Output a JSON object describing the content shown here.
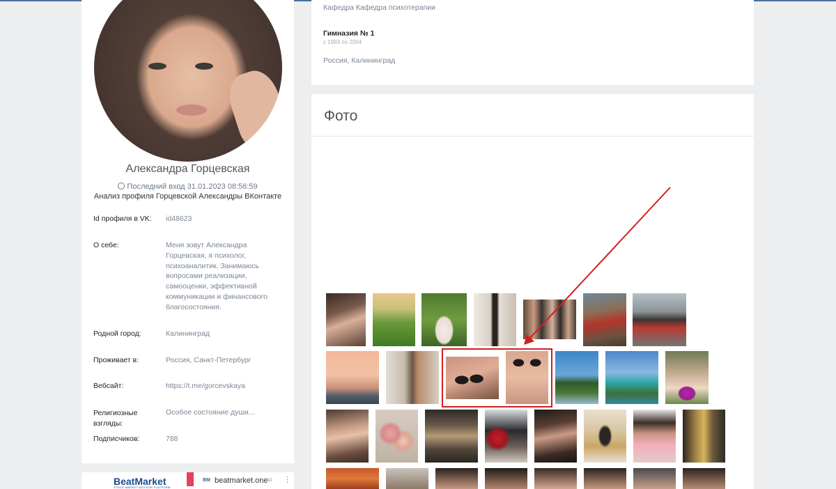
{
  "profile": {
    "name": "Александра Горцевская",
    "last_seen": "Последний вход 31.01.2023 08:56:59",
    "analysis": "Анализ профиля Горцевской Александры ВКонтакте",
    "info": [
      {
        "label": "Id профиля в VK:",
        "value": "id48623"
      },
      {
        "label": "О себе:",
        "value": "Меня зовут Александра Горцевская, я психолог, психоаналитик. Занимаюсь вопросами реализации, самооценки, эффективной коммуникации и финансового благосостояния."
      },
      {
        "label": "Родной город:",
        "value": "Калининград"
      },
      {
        "label": "Проживает в:",
        "value": "Россия, Санкт-Петербург"
      },
      {
        "label": "Вебсайт:",
        "value": "https://t.me/gorcevskaya"
      },
      {
        "label": "Религиозные взгляды:",
        "value": "Особое состояние души..."
      },
      {
        "label": "Подписчиков:",
        "value": "788"
      }
    ]
  },
  "education": {
    "department": "Кафедра Кафедра психотерапии",
    "school": "Гимназия № 1",
    "years": "с 1993 по 2004",
    "city": "Россия, Калининград"
  },
  "photos": {
    "title": "Фото"
  },
  "ad": {
    "brand": "BeatMarket",
    "tagline": "STOCK MARKET ADVISOR PLATFORM",
    "badge": "BM",
    "site": "beatmarket.one",
    "label": "AD",
    "menu_icon": "more-vertical-icon"
  },
  "colors": {
    "background": "#edeef0",
    "highlight": "#d01f1f",
    "arrow": "#d01f1f"
  }
}
